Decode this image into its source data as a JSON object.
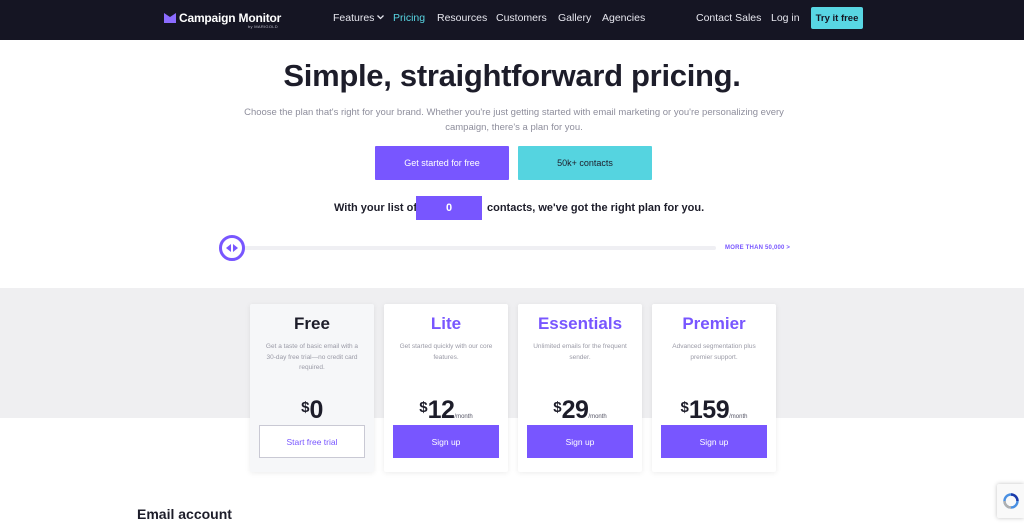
{
  "nav": {
    "brand": "Campaign Monitor",
    "brand_sub": "by MARIGOLD",
    "links": {
      "features": "Features",
      "pricing": "Pricing",
      "resources": "Resources",
      "customers": "Customers",
      "gallery": "Gallery",
      "agencies": "Agencies",
      "contact_sales": "Contact Sales",
      "log_in": "Log in"
    },
    "cta": "Try it free",
    "active": "Pricing"
  },
  "hero": {
    "title": "Simple, straightforward pricing.",
    "subtitle": "Choose the plan that's right for your brand. Whether you're just getting started with email marketing or you're personalizing every campaign, there's a plan for you.",
    "tab_primary": "Get started for free",
    "tab_secondary": "50k+ contacts"
  },
  "contacts": {
    "prefix": "With your list of",
    "value": "0",
    "suffix": "contacts, we've got the right plan for you."
  },
  "slider": {
    "value_fraction": 0,
    "more_label": "MORE THAN 50,000 >"
  },
  "plans": [
    {
      "name": "Free",
      "description": "Get a taste of basic email with a 30-day free trial—no credit card required.",
      "currency": "$",
      "price": "0",
      "period": "",
      "button": "Start free trial"
    },
    {
      "name": "Lite",
      "description": "Get started quickly with our core features.",
      "currency": "$",
      "price": "12",
      "period": "/month",
      "button": "Sign up"
    },
    {
      "name": "Essentials",
      "description": "Unlimited emails for the frequent sender.",
      "currency": "$",
      "price": "29",
      "period": "/month",
      "button": "Sign up"
    },
    {
      "name": "Premier",
      "description": "Advanced segmentation plus premier support.",
      "currency": "$",
      "price": "159",
      "period": "/month",
      "button": "Sign up"
    }
  ],
  "section": {
    "title": "Email account"
  },
  "colors": {
    "nav_bg": "#151523",
    "accent_purple": "#7856ff",
    "accent_cyan": "#58d6e3"
  }
}
